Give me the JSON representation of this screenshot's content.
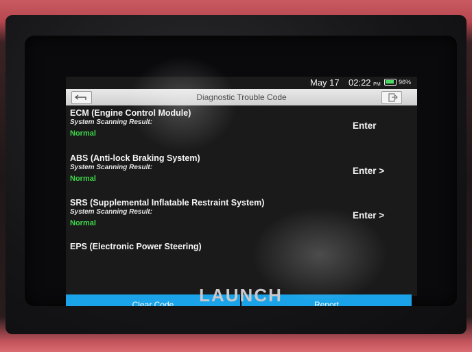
{
  "status": {
    "date": "May 17",
    "time": "02:22",
    "ampm": "PM",
    "battery": "96%",
    "battery_level": 0.96
  },
  "header": {
    "title": "Diagnostic Trouble Code",
    "back_icon": "back-arrow-icon",
    "exit_icon": "exit-icon"
  },
  "systems": [
    {
      "name": "ECM (Engine Control Module)",
      "result_label": "System Scanning Result:",
      "result": "Normal",
      "action": "Enter"
    },
    {
      "name": "ABS (Anti-lock Braking System)",
      "result_label": "System Scanning Result:",
      "result": "Normal",
      "action": "Enter >"
    },
    {
      "name": "SRS (Supplemental Inflatable Restraint System)",
      "result_label": "System Scanning Result:",
      "result": "Normal",
      "action": "Enter >"
    },
    {
      "name": "EPS (Electronic Power Steering)"
    }
  ],
  "footer": {
    "clear_label": "Clear Code",
    "report_label": "Report"
  },
  "device": {
    "brand": "LAUNCH"
  },
  "colors": {
    "accent": "#1aa3e8",
    "normal": "#3ed84a",
    "casing": "#c95a62"
  }
}
